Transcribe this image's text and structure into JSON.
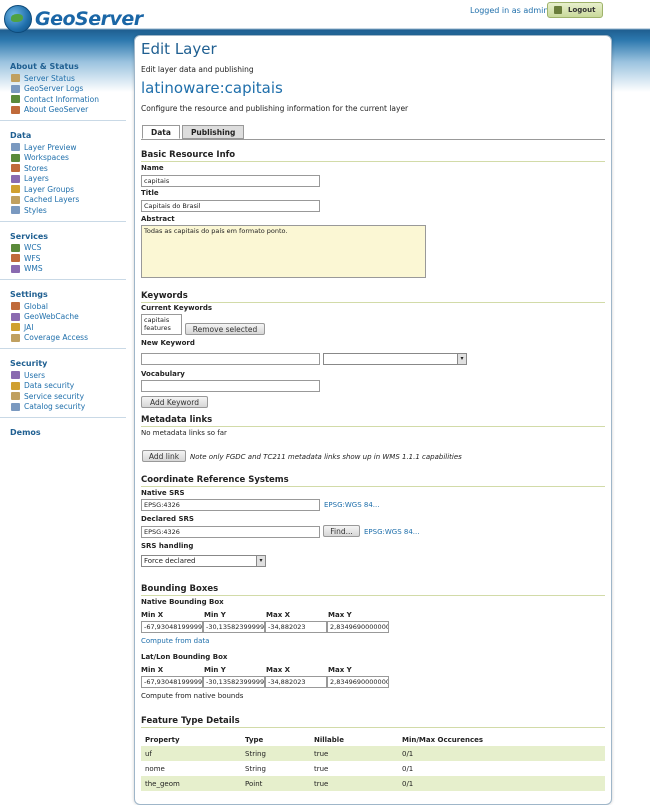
{
  "header": {
    "logo_text": "GeoServer",
    "login_status": "Logged in as admin.",
    "logout_label": "Logout"
  },
  "sidebar": {
    "groups": [
      {
        "title": "About & Status",
        "items": [
          {
            "label": "Server Status",
            "icon": "server-status-icon"
          },
          {
            "label": "GeoServer Logs",
            "icon": "logs-icon"
          },
          {
            "label": "Contact Information",
            "icon": "contact-icon"
          },
          {
            "label": "About GeoServer",
            "icon": "info-icon"
          }
        ]
      },
      {
        "title": "Data",
        "items": [
          {
            "label": "Layer Preview",
            "icon": "layer-preview-icon"
          },
          {
            "label": "Workspaces",
            "icon": "folder-icon"
          },
          {
            "label": "Stores",
            "icon": "store-icon"
          },
          {
            "label": "Layers",
            "icon": "layers-icon"
          },
          {
            "label": "Layer Groups",
            "icon": "layer-group-icon"
          },
          {
            "label": "Cached Layers",
            "icon": "cache-icon"
          },
          {
            "label": "Styles",
            "icon": "style-icon"
          }
        ]
      },
      {
        "title": "Services",
        "items": [
          {
            "label": "WCS",
            "icon": "service-icon"
          },
          {
            "label": "WFS",
            "icon": "service-icon"
          },
          {
            "label": "WMS",
            "icon": "service-icon"
          }
        ]
      },
      {
        "title": "Settings",
        "items": [
          {
            "label": "Global",
            "icon": "global-icon"
          },
          {
            "label": "GeoWebCache",
            "icon": "geowebcache-icon"
          },
          {
            "label": "JAI",
            "icon": "jai-icon"
          },
          {
            "label": "Coverage Access",
            "icon": "coverage-icon"
          }
        ]
      },
      {
        "title": "Security",
        "items": [
          {
            "label": "Users",
            "icon": "users-icon"
          },
          {
            "label": "Data security",
            "icon": "data-security-icon"
          },
          {
            "label": "Service security",
            "icon": "service-security-icon"
          },
          {
            "label": "Catalog security",
            "icon": "catalog-security-icon"
          }
        ]
      },
      {
        "title": "Demos",
        "items": []
      }
    ]
  },
  "main": {
    "title": "Edit Layer",
    "description": "Edit layer data and publishing",
    "layer_name": "latinoware:capitais",
    "layer_description": "Configure the resource and publishing information for the current layer",
    "tabs": [
      "Data",
      "Publishing"
    ]
  },
  "basic_resource": {
    "heading": "Basic Resource Info",
    "name_label": "Name",
    "name_value": "capitais",
    "title_label": "Title",
    "title_value": "Capitais do Brasil",
    "abstract_label": "Abstract",
    "abstract_value": "Todas as capitais do país em formato ponto."
  },
  "keywords": {
    "heading": "Keywords",
    "current_label": "Current Keywords",
    "current": [
      "capitais",
      "features"
    ],
    "remove_label": "Remove selected",
    "new_label": "New Keyword",
    "vocabulary_label": "Vocabulary",
    "add_label": "Add Keyword"
  },
  "metadata": {
    "heading": "Metadata links",
    "empty_text": "No metadata links so far",
    "add_link_label": "Add link",
    "note": "Note only FGDC and TC211 metadata links show up in WMS 1.1.1 capabilities"
  },
  "crs": {
    "heading": "Coordinate Reference Systems",
    "native_label": "Native SRS",
    "native_value": "EPSG:4326",
    "native_link": "EPSG:WGS 84...",
    "declared_label": "Declared SRS",
    "declared_value": "EPSG:4326",
    "find_label": "Find...",
    "declared_link": "EPSG:WGS 84...",
    "handling_label": "SRS handling",
    "handling_value": "Force declared"
  },
  "bbox": {
    "heading": "Bounding Boxes",
    "native_label": "Native Bounding Box",
    "col_labels": [
      "Min X",
      "Min Y",
      "Max X",
      "Max Y"
    ],
    "native_values": [
      "-67,93048199999",
      "-30,13582399999",
      "-34,882023",
      "2,8349690000000"
    ],
    "compute_data_link": "Compute from data",
    "latlon_label": "Lat/Lon Bounding Box",
    "latlon_values": [
      "-67,93048199999",
      "-30,13582399999",
      "-34,882023",
      "2,8349690000000"
    ],
    "compute_native_text": "Compute from native bounds"
  },
  "feature_types": {
    "heading": "Feature Type Details",
    "columns": [
      "Property",
      "Type",
      "Nillable",
      "Min/Max Occurences"
    ],
    "rows": [
      [
        "uf",
        "String",
        "true",
        "0/1"
      ],
      [
        "nome",
        "String",
        "true",
        "0/1"
      ],
      [
        "the_geom",
        "Point",
        "true",
        "0/1"
      ]
    ]
  }
}
